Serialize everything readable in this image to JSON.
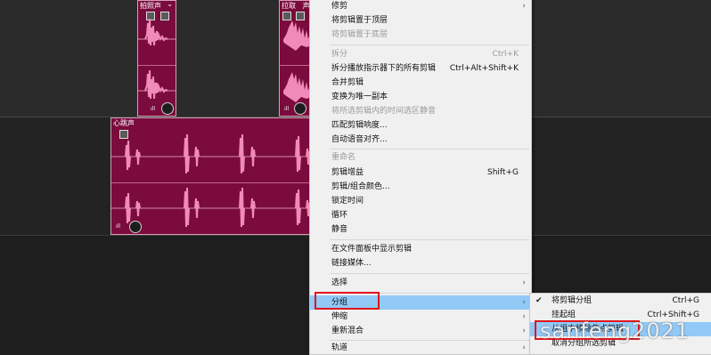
{
  "clips": {
    "clip1_title": "拍照声",
    "clip2_title": "拉取",
    "clip2_suffix": "声",
    "clip3_title": "心跳声"
  },
  "main_menu": {
    "items": [
      {
        "label": "修剪",
        "shortcut": "",
        "submenu": true,
        "disabled": false
      },
      {
        "label": "将剪辑置于顶层",
        "shortcut": "",
        "submenu": false,
        "disabled": false
      },
      {
        "label": "将剪辑置于底层",
        "shortcut": "",
        "submenu": false,
        "disabled": true
      },
      {
        "label": "拆分",
        "shortcut": "Ctrl+K",
        "submenu": false,
        "disabled": true
      },
      {
        "label": "拆分播放指示器下的所有剪辑",
        "shortcut": "Ctrl+Alt+Shift+K",
        "submenu": false,
        "disabled": false
      },
      {
        "label": "合并剪辑",
        "shortcut": "",
        "submenu": false,
        "disabled": false
      },
      {
        "label": "变换为唯一副本",
        "shortcut": "",
        "submenu": false,
        "disabled": false
      },
      {
        "label": "将所选剪辑内的时间选区静音",
        "shortcut": "",
        "submenu": false,
        "disabled": true
      },
      {
        "label": "匹配剪辑响度...",
        "shortcut": "",
        "submenu": false,
        "disabled": false
      },
      {
        "label": "自动语音对齐...",
        "shortcut": "",
        "submenu": false,
        "disabled": false
      },
      {
        "label": "重命名",
        "shortcut": "",
        "submenu": false,
        "disabled": true
      },
      {
        "label": "剪辑增益",
        "shortcut": "Shift+G",
        "submenu": false,
        "disabled": false
      },
      {
        "label": "剪辑/组合颜色...",
        "shortcut": "",
        "submenu": false,
        "disabled": false
      },
      {
        "label": "锁定时间",
        "shortcut": "",
        "submenu": false,
        "disabled": false
      },
      {
        "label": "循环",
        "shortcut": "",
        "submenu": false,
        "disabled": false
      },
      {
        "label": "静音",
        "shortcut": "",
        "submenu": false,
        "disabled": false
      },
      {
        "label": "在文件面板中显示剪辑",
        "shortcut": "",
        "submenu": false,
        "disabled": false
      },
      {
        "label": "链接媒体...",
        "shortcut": "",
        "submenu": false,
        "disabled": false
      },
      {
        "label": "选择",
        "shortcut": "",
        "submenu": true,
        "disabled": false
      },
      {
        "label": "分组",
        "shortcut": "",
        "submenu": true,
        "disabled": false
      },
      {
        "label": "伸缩",
        "shortcut": "",
        "submenu": true,
        "disabled": false
      },
      {
        "label": "重新混合",
        "shortcut": "",
        "submenu": true,
        "disabled": false
      },
      {
        "label": "轨道",
        "shortcut": "",
        "submenu": true,
        "disabled": false
      }
    ]
  },
  "sub_menu": {
    "items": [
      {
        "label": "将剪辑分组",
        "shortcut": "Ctrl+G",
        "checked": true
      },
      {
        "label": "挂起组",
        "shortcut": "Ctrl+Shift+G",
        "checked": false
      },
      {
        "label": "从组中移除焦点剪辑",
        "shortcut": "",
        "checked": false
      },
      {
        "label": "取消分组所选剪辑",
        "shortcut": "",
        "checked": false
      }
    ]
  },
  "watermark": "sanfeng2021",
  "colors": {
    "clip": "#7a0b3c",
    "wave": "#f08ab8",
    "highlight": "#91c9f7",
    "annotation": "#e1141c"
  }
}
